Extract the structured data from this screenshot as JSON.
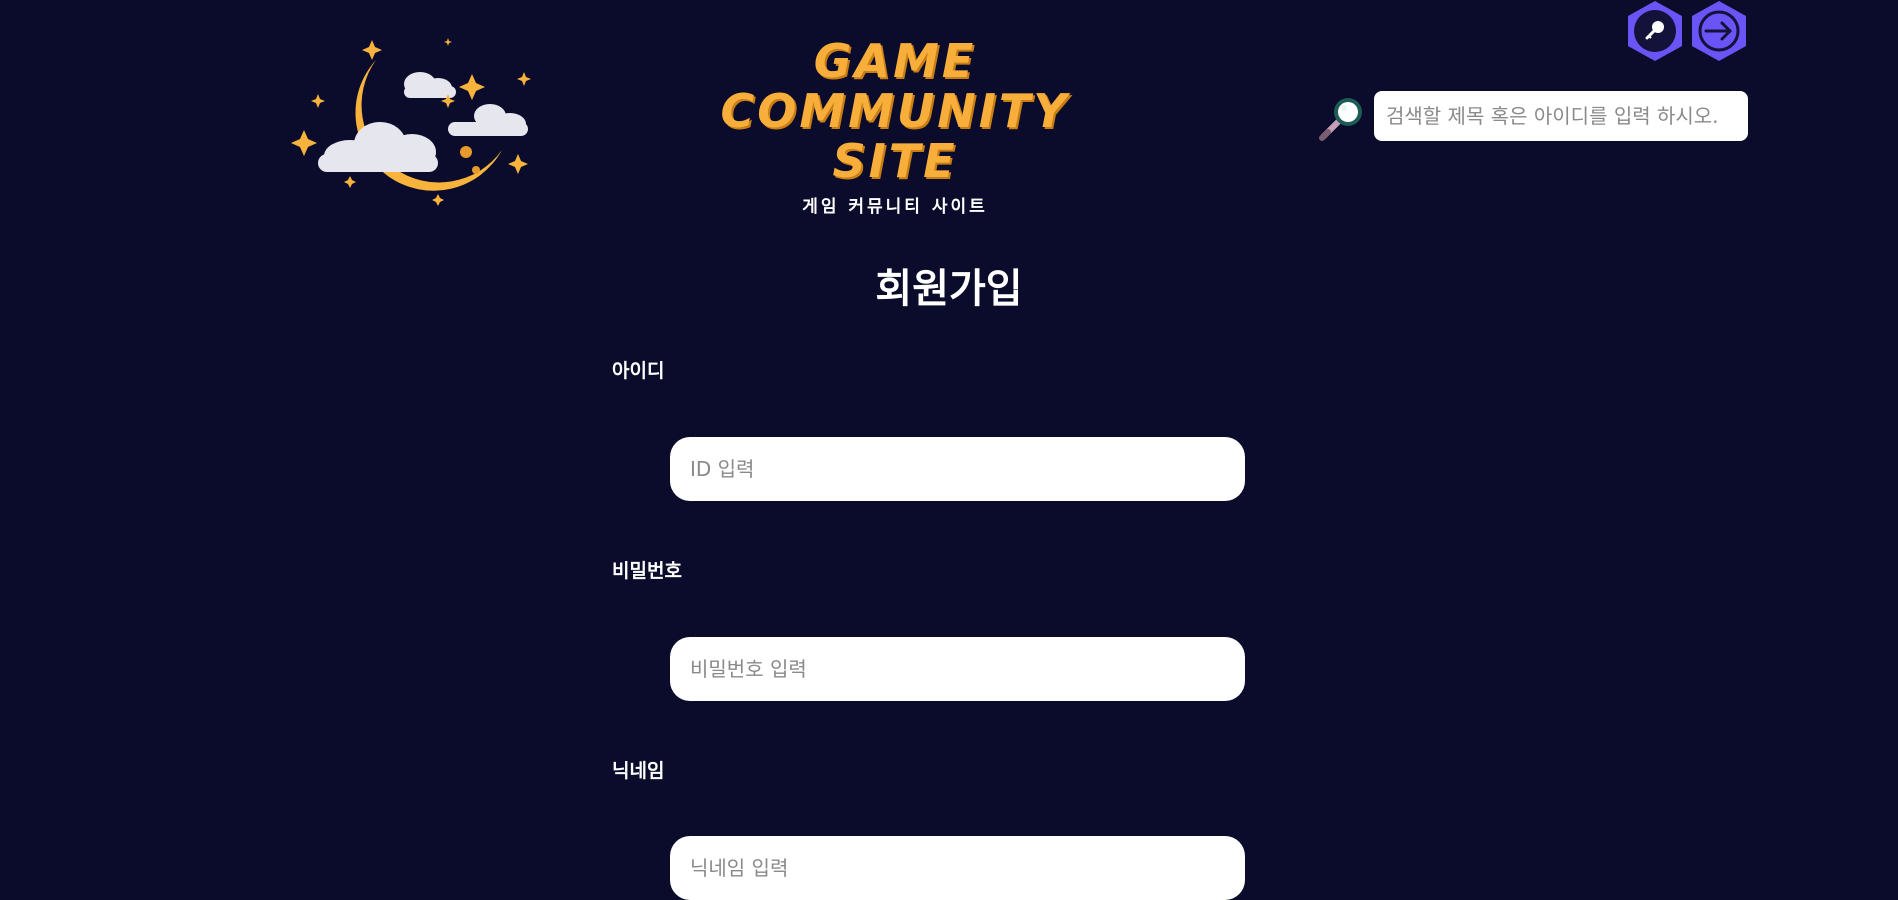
{
  "header": {
    "logo_line1": "GAME",
    "logo_line2": "COMMUNITY",
    "logo_line3": "SITE",
    "logo_subtitle": "게임 커뮤니티 사이트",
    "icons": {
      "moon": "moon-cloud-logo",
      "login": "key-icon",
      "signup": "arrow-right-circle-icon",
      "search": "magnifier-icon"
    },
    "search_placeholder": "검색할 제목 혹은 아이디를 입력 하시오."
  },
  "signup": {
    "title": "회원가입",
    "id_label": "아이디",
    "id_placeholder": "ID 입력",
    "password_label": "비밀번호",
    "password_placeholder": "비밀번호 입력",
    "nickname_label": "닉네임",
    "nickname_placeholder": "닉네임 입력"
  },
  "colors": {
    "background": "#0b0c2c",
    "logo_orange": "#f7ae3a",
    "button_purple": "#6a54f5",
    "text": "#ffffff"
  }
}
